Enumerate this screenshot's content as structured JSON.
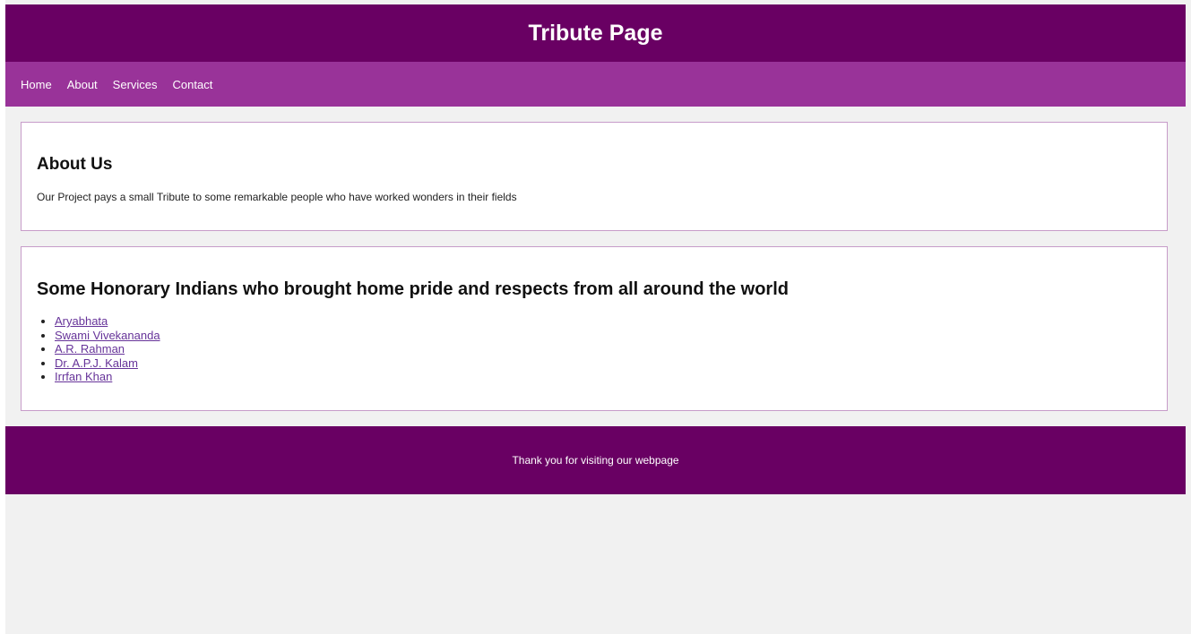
{
  "header": {
    "title": "Tribute Page"
  },
  "nav": {
    "items": [
      {
        "label": "Home"
      },
      {
        "label": "About"
      },
      {
        "label": "Services"
      },
      {
        "label": "Contact"
      }
    ]
  },
  "about": {
    "heading": "About Us",
    "text": "Our Project pays a small Tribute to some remarkable people who have worked wonders in their fields"
  },
  "honorary": {
    "heading": "Some Honorary Indians who brought home pride and respects from all around the world",
    "people": [
      {
        "name": "Aryabhata"
      },
      {
        "name": "Swami Vivekananda"
      },
      {
        "name": "A.R. Rahman"
      },
      {
        "name": "Dr. A.P.J. Kalam"
      },
      {
        "name": "Irrfan Khan"
      }
    ]
  },
  "footer": {
    "text": "Thank you for visiting our webpage"
  },
  "colors": {
    "header_bg": "#690063",
    "nav_bg": "#993399",
    "page_bg": "#f1f1f1",
    "card_border": "#c79cc9",
    "link": "#663399"
  }
}
